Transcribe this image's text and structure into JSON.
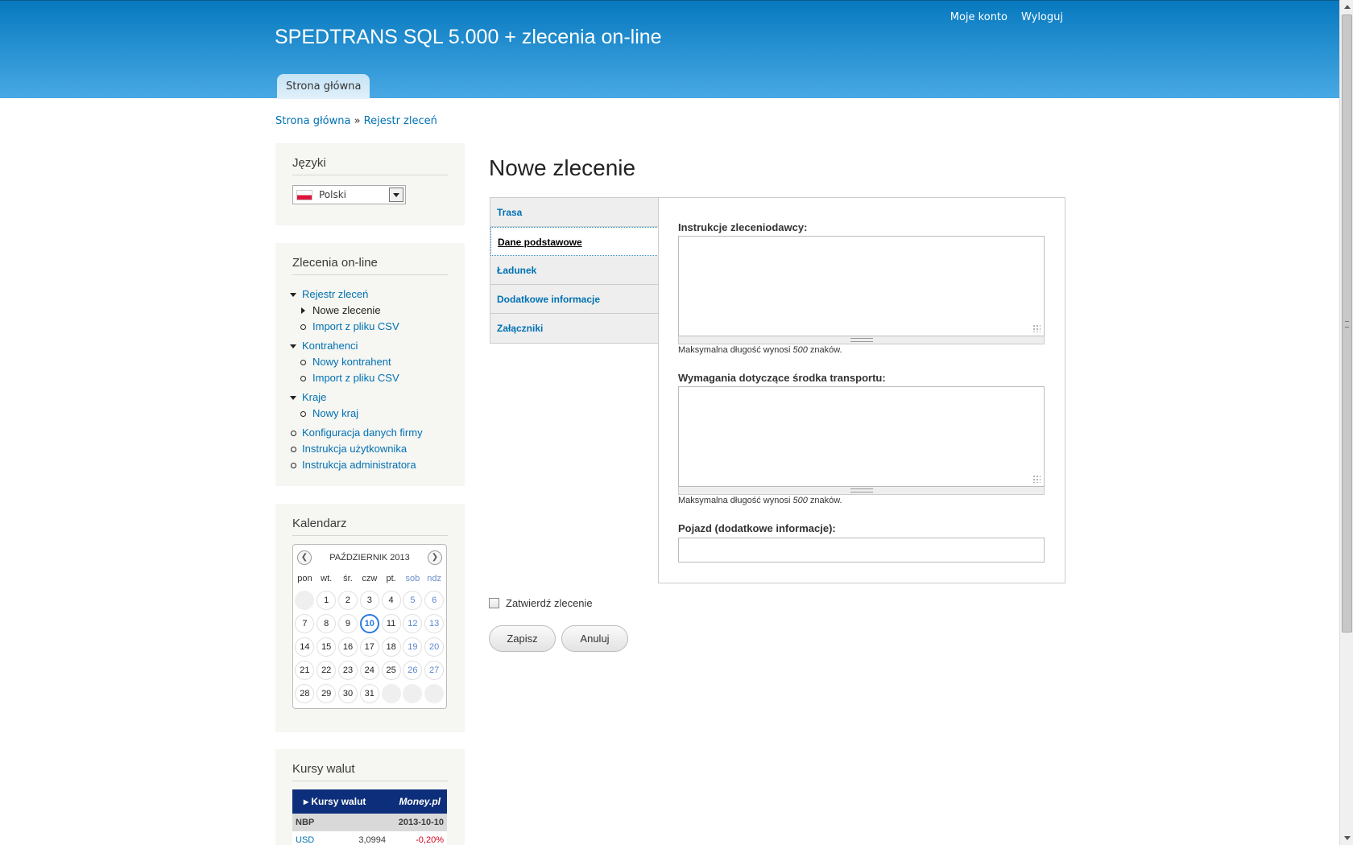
{
  "header": {
    "site_name": "SPEDTRANS SQL 5.000 + zlecenia on-line",
    "my_account": "Moje konto",
    "logout": "Wyloguj",
    "main_tab": "Strona główna"
  },
  "breadcrumb": {
    "home": "Strona główna",
    "sep": " » ",
    "current": "Rejestr zleceń"
  },
  "languages": {
    "title": "Języki",
    "selected": "Polski"
  },
  "orders_menu": {
    "title": "Zlecenia on-line",
    "items": [
      "Rejestr zleceń",
      "Nowe zlecenie",
      "Import z pliku CSV",
      "Kontrahenci",
      "Nowy kontrahent",
      "Import z pliku CSV",
      "Kraje",
      "Nowy kraj",
      "Konfiguracja danych firmy",
      "Instrukcja użytkownika",
      "Instrukcja administratora"
    ]
  },
  "calendar": {
    "title": "Kalendarz",
    "month": "PAŹDZIERNIK 2013",
    "dow": [
      "pon",
      "wt.",
      "śr.",
      "czw",
      "pt.",
      "sob",
      "ndz"
    ],
    "days": [
      "",
      "1",
      "2",
      "3",
      "4",
      "5",
      "6",
      "7",
      "8",
      "9",
      "10",
      "11",
      "12",
      "13",
      "14",
      "15",
      "16",
      "17",
      "18",
      "19",
      "20",
      "21",
      "22",
      "23",
      "24",
      "25",
      "26",
      "27",
      "28",
      "29",
      "30",
      "31",
      "",
      "",
      ""
    ],
    "today": "10"
  },
  "currency": {
    "title": "Kursy walut",
    "widget_title": "Kursy walut",
    "brand": "Money.pl",
    "source": "NBP",
    "date": "2013-10-10",
    "rows": [
      {
        "code": "USD",
        "rate": "3,0994",
        "change": "-0,20%"
      }
    ]
  },
  "content": {
    "title": "Nowe zlecenie",
    "tabs": [
      "Trasa",
      "Dane podstawowe",
      "Ładunek",
      "Dodatkowe informacje",
      "Załączniki"
    ],
    "fields": {
      "instructions_label": "Instrukcje zleceniodawcy:",
      "instructions_value": "",
      "desc_prefix": "Maksymalna długość wynosi ",
      "desc_num": "500",
      "desc_suffix": " znaków.",
      "transport_label": "Wymagania dotyczące środka transportu:",
      "transport_value": "",
      "vehicle_label": "Pojazd (dodatkowe informacje):",
      "vehicle_value": ""
    },
    "confirm_label": "Zatwierdź zlecenie",
    "save": "Zapisz",
    "cancel": "Anuluj"
  }
}
